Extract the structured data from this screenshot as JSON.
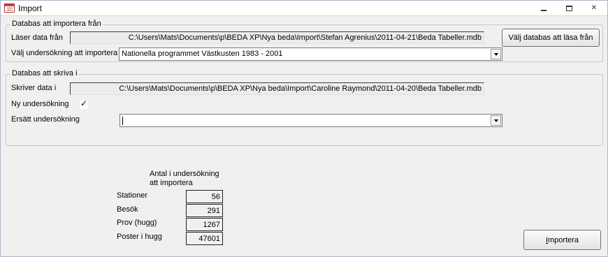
{
  "window": {
    "title": "Import"
  },
  "import_group": {
    "title": "Databas att importera från",
    "read_label": "Läser data från",
    "read_path": "C:\\Users\\Mats\\Documents\\p\\BEDA XP\\Nya beda\\Import\\Stefan Agrenius\\2011-04-21\\Beda Tabeller.mdb",
    "survey_label": "Välj undersökning att importera",
    "survey_value": "Nationella programmet Västkusten 1983 - 2001",
    "choose_button": "Välj databas att läsa från"
  },
  "write_group": {
    "title": "Databas att skriva i",
    "write_label": "Skriver data i",
    "write_path": "C:\\Users\\Mats\\Documents\\p\\BEDA XP\\Nya beda\\Import\\Caroline Raymond\\2011-04-20\\Beda Tabeller.mdb",
    "new_survey_label": "Ny undersökning",
    "new_survey_checked": true,
    "replace_label": "Ersätt undersökning",
    "replace_value": ""
  },
  "stats": {
    "header_line1": "Antal i undersökning",
    "header_line2": "att importera",
    "rows": [
      {
        "label": "Stationer",
        "value": "56"
      },
      {
        "label": "Besök",
        "value": "291"
      },
      {
        "label": "Prov (hugg)",
        "value": "1267"
      },
      {
        "label": "Poster i hugg",
        "value": "47601"
      }
    ]
  },
  "import_button": {
    "label_prefix": "",
    "label_underlined": "I",
    "label_rest": "mportera"
  }
}
